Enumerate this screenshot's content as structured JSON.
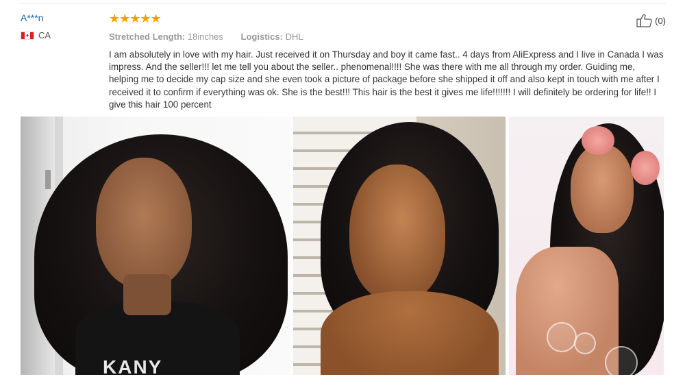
{
  "review": {
    "reviewer": {
      "name": "A***n",
      "country_code": "CA",
      "flag": "canada-flag"
    },
    "rating": {
      "stars": 5,
      "max": 5,
      "display": "★★★★★"
    },
    "meta": {
      "length_label": "Stretched Length:",
      "length_value": "18inches",
      "logistics_label": "Logistics:",
      "logistics_value": "DHL"
    },
    "text": "I am absolutely in love with my hair. Just received it on Thursday and boy it came fast.. 4 days from AliExpress and I live in Canada I was impress. And the seller!!! let me tell you about the seller.. phenomenal!!!! She was there with me all through my order. Guiding me, helping me to decide my cap size and she even took a picture of package before she shipped it off and also kept in touch with me after I received it to confirm if everything was ok. She is the best!!! This hair is the best it gives me life!!!!!!! I will definitely be ordering for life!! I give this hair 100 percent",
    "helpful": {
      "count_label": "(0)",
      "icon": "thumbs-up-icon"
    }
  },
  "photos": {
    "shirt_text": "KANY",
    "colors": {
      "star": "#f2a100",
      "name": "#1a5fb4"
    }
  }
}
